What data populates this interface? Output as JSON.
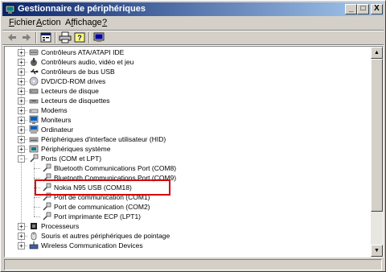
{
  "window": {
    "title": "Gestionnaire de périphériques",
    "min_label": "_",
    "max_label": "□",
    "close_label": "X"
  },
  "menu": {
    "items": [
      {
        "label": "Fichier",
        "accel": "F"
      },
      {
        "label": "Action",
        "accel": "A"
      },
      {
        "label": "Affichage",
        "accel": "f"
      },
      {
        "label": "?",
        "accel": "?"
      }
    ]
  },
  "toolbar": {
    "buttons": [
      "back-icon",
      "forward-icon",
      "properties-view-icon",
      "print-icon",
      "help-icon",
      "scan-hardware-icon"
    ]
  },
  "tree": {
    "nodes": [
      {
        "label": "Contrôleurs ATA/ATAPI IDE",
        "expander": "+",
        "icon": "ide-controller-icon",
        "level": 1
      },
      {
        "label": "Contrôleurs audio, vidéo et jeu",
        "expander": "+",
        "icon": "sound-icon",
        "level": 1
      },
      {
        "label": "Contrôleurs de bus USB",
        "expander": "+",
        "icon": "usb-icon",
        "level": 1
      },
      {
        "label": "DVD/CD-ROM drives",
        "expander": "+",
        "icon": "dvd-icon",
        "level": 1
      },
      {
        "label": "Lecteurs de disque",
        "expander": "+",
        "icon": "disk-icon",
        "level": 1
      },
      {
        "label": "Lecteurs de disquettes",
        "expander": "+",
        "icon": "floppy-icon",
        "level": 1
      },
      {
        "label": "Modems",
        "expander": "+",
        "icon": "modem-icon",
        "level": 1
      },
      {
        "label": "Moniteurs",
        "expander": "+",
        "icon": "monitor-icon",
        "level": 1
      },
      {
        "label": "Ordinateur",
        "expander": "+",
        "icon": "computer-icon",
        "level": 1
      },
      {
        "label": "Périphériques d'interface utilisateur (HID)",
        "expander": "+",
        "icon": "hid-icon",
        "level": 1
      },
      {
        "label": "Périphériques système",
        "expander": "+",
        "icon": "system-icon",
        "level": 1
      },
      {
        "label": "Ports (COM et LPT)",
        "expander": "-",
        "icon": "port-icon",
        "level": 1
      },
      {
        "label": "Bluetooth Communications Port (COM8)",
        "expander": "",
        "icon": "port-icon",
        "level": 2
      },
      {
        "label": "Bluetooth Communications Port (COM9)",
        "expander": "",
        "icon": "port-icon",
        "level": 2
      },
      {
        "label": "Nokia N95 USB (COM18)",
        "expander": "",
        "icon": "port-icon",
        "level": 2
      },
      {
        "label": "Port de communication (COM1)",
        "expander": "",
        "icon": "port-icon",
        "level": 2
      },
      {
        "label": "Port de communication (COM2)",
        "expander": "",
        "icon": "port-icon",
        "level": 2
      },
      {
        "label": "Port imprimante ECP (LPT1)",
        "expander": "",
        "icon": "port-icon",
        "level": 2
      },
      {
        "label": "Processeurs",
        "expander": "+",
        "icon": "processor-icon",
        "level": 1
      },
      {
        "label": "Souris et autres périphériques de pointage",
        "expander": "+",
        "icon": "mouse-icon",
        "level": 1
      },
      {
        "label": "Wireless Communication Devices",
        "expander": "+",
        "icon": "wireless-icon",
        "level": 1
      }
    ]
  },
  "colors": {
    "title_gradient_start": "#0a246a",
    "title_gradient_end": "#a6caf0",
    "highlight": "#d40000"
  },
  "statusbar": {
    "text": ""
  }
}
